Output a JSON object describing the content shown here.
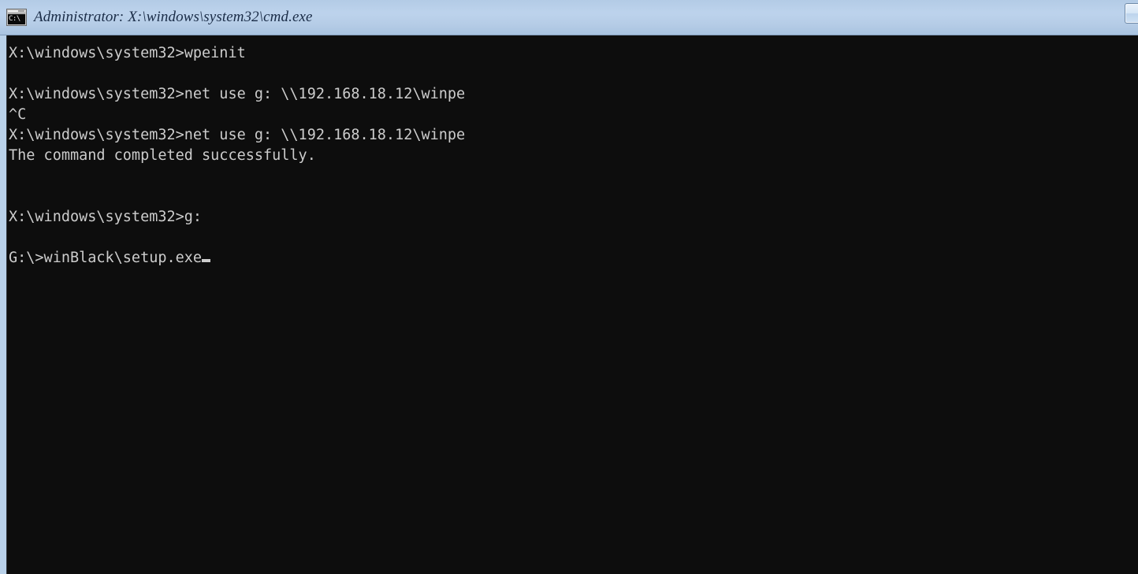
{
  "window": {
    "title": "Administrator: X:\\windows\\system32\\cmd.exe",
    "icon_name": "cmd-console-icon",
    "icon_glyph": "C:\\",
    "titlebar_color": "#b9d1e9",
    "title_text_color": "#1a2c47",
    "console_background": "#0d0d0d",
    "console_text_color": "#cccccc"
  },
  "caption_buttons": [
    {
      "name": "restore-button",
      "label": ""
    }
  ],
  "console": {
    "lines": [
      {
        "text": "X:\\windows\\system32>wpeinit",
        "blank": false
      },
      {
        "text": "",
        "blank": true
      },
      {
        "text": "X:\\windows\\system32>net use g: \\\\192.168.18.12\\winpe",
        "blank": false
      },
      {
        "text": "^C",
        "blank": false
      },
      {
        "text": "X:\\windows\\system32>net use g: \\\\192.168.18.12\\winpe",
        "blank": false
      },
      {
        "text": "The command completed successfully.",
        "blank": false
      },
      {
        "text": "",
        "blank": true
      },
      {
        "text": "",
        "blank": true
      },
      {
        "text": "X:\\windows\\system32>g:",
        "blank": false
      },
      {
        "text": "",
        "blank": true
      },
      {
        "text": "G:\\>winBlack\\setup.exe",
        "blank": false,
        "cursor": true
      }
    ]
  }
}
